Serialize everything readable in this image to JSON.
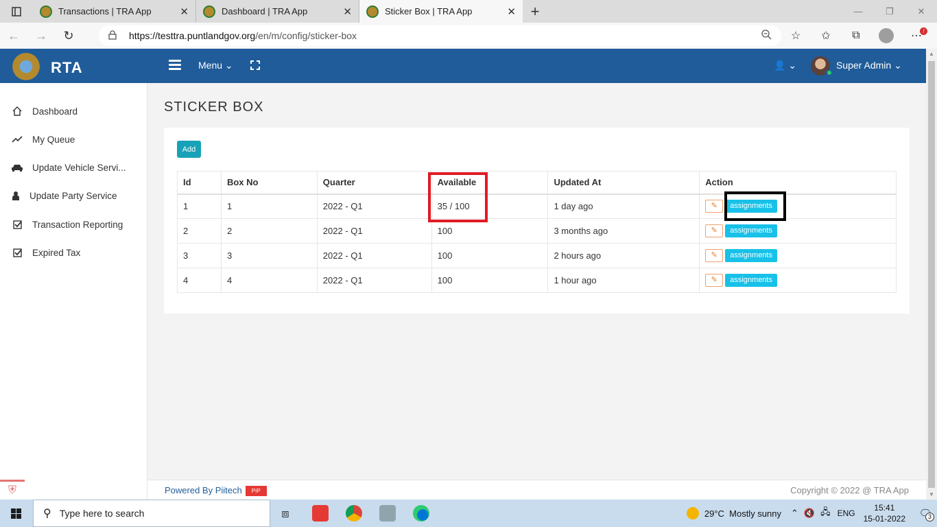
{
  "browser": {
    "tabs": [
      {
        "title": "Transactions | TRA App"
      },
      {
        "title": "Dashboard | TRA App"
      },
      {
        "title": "Sticker Box | TRA App"
      }
    ],
    "url_host": "https://testtra.puntlandgov.org",
    "url_path": "/en/m/config/sticker-box"
  },
  "app": {
    "brand": "RTA",
    "menu_label": "Menu",
    "user_name": "Super Admin"
  },
  "sidebar": {
    "items": [
      {
        "label": "Dashboard",
        "icon": "home-icon"
      },
      {
        "label": "My Queue",
        "icon": "trend-line-icon"
      },
      {
        "label": "Update Vehicle Servi...",
        "icon": "car-icon"
      },
      {
        "label": "Update Party Service",
        "icon": "person-icon"
      },
      {
        "label": "Transaction Reporting",
        "icon": "check-square-icon"
      },
      {
        "label": "Expired Tax",
        "icon": "check-square-icon"
      }
    ]
  },
  "page": {
    "title": "STICKER BOX",
    "add_label": "Add"
  },
  "table": {
    "headers": [
      "Id",
      "Box No",
      "Quarter",
      "Available",
      "Updated At",
      "Action"
    ],
    "rows": [
      {
        "id": "1",
        "box_no": "1",
        "quarter": "2022 - Q1",
        "available": "35 / 100",
        "updated_at": "1 day ago",
        "action": "assignments"
      },
      {
        "id": "2",
        "box_no": "2",
        "quarter": "2022 - Q1",
        "available": "100",
        "updated_at": "3 months ago",
        "action": "assignments"
      },
      {
        "id": "3",
        "box_no": "3",
        "quarter": "2022 - Q1",
        "available": "100",
        "updated_at": "2 hours ago",
        "action": "assignments"
      },
      {
        "id": "4",
        "box_no": "4",
        "quarter": "2022 - Q1",
        "available": "100",
        "updated_at": "1 hour ago",
        "action": "assignments"
      }
    ]
  },
  "footer": {
    "powered_by": "Powered By Piitech",
    "pt_logo": "PIP",
    "copyright": "Copyright © 2022 @ TRA App"
  },
  "taskbar": {
    "search_placeholder": "Type here to search",
    "weather": "29°C  Mostly sunny",
    "language": "ENG",
    "time": "15:41",
    "date": "15-01-2022",
    "notifications": "3"
  },
  "colors": {
    "header": "#1f5c99",
    "accent": "#17a2b8",
    "highlight_red": "#e01b24"
  }
}
